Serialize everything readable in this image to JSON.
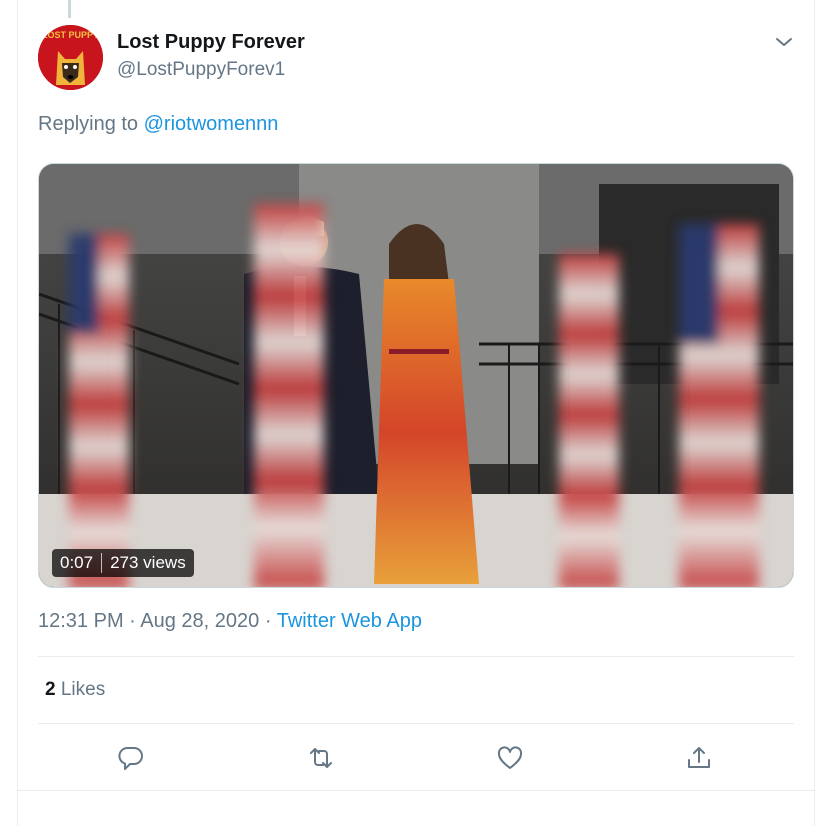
{
  "tweet": {
    "author": {
      "display_name": "Lost Puppy Forever",
      "handle": "@LostPuppyForev1",
      "avatar_text": "LOST PUPPY"
    },
    "reply_label": "Replying to ",
    "reply_handle": "@riotwomennn",
    "video": {
      "duration": "0:07",
      "views": "273 views"
    },
    "time": "12:31 PM",
    "sep": " · ",
    "date": "Aug 28, 2020",
    "source": "Twitter Web App",
    "likes_count": "2",
    "likes_label": "Likes"
  },
  "colors": {
    "link": "#1b95e0",
    "secondary_text": "#657786",
    "border": "#e6ecf0",
    "avatar_bg": "#c8141d"
  },
  "icons": [
    "chevron-down-icon",
    "reply-icon",
    "retweet-icon",
    "like-icon",
    "share-icon"
  ]
}
